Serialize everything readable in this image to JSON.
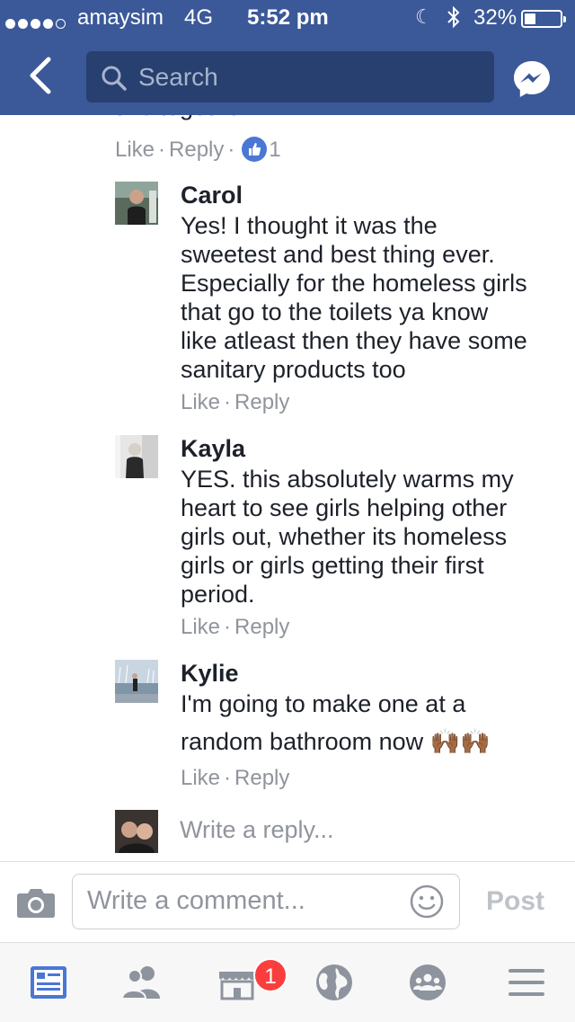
{
  "status_bar": {
    "carrier": "amaysim",
    "network": "4G",
    "time": "5:52 pm",
    "battery": "32%",
    "battery_level": 0.32
  },
  "header": {
    "search_placeholder": "Search"
  },
  "comment": {
    "cut_text": "this together!",
    "like": "Like",
    "reply": "Reply",
    "like_count": "1"
  },
  "replies": [
    {
      "name": "Carol",
      "text": "Yes! I thought it was the\nsweetest and best thing ever.\nEspecially for the homeless girls\nthat go to the toilets ya know\nlike atleast then they have some\nsanitary products too",
      "like": "Like",
      "reply": "Reply"
    },
    {
      "name": "Kayla",
      "text": "YES. this absolutely warms my\nheart to see girls helping other\ngirls out, whether its homeless\ngirls or girls getting their first\nperiod.",
      "like": "Like",
      "reply": "Reply"
    },
    {
      "name": "Kylie",
      "text_line1": "I'm going to make one at a",
      "text_line2": "random bathroom now",
      "emoji": "🙌🏾🙌🏾",
      "like": "Like",
      "reply": "Reply"
    }
  ],
  "write_reply_placeholder": "Write a reply...",
  "composer": {
    "placeholder": "Write a comment...",
    "post_label": "Post"
  },
  "tabbar": {
    "marketplace_badge": "1"
  },
  "colors": {
    "header_blue": "#3b5998",
    "link_blue": "#4a77d4",
    "badge_red": "#fa3e3e",
    "meta_gray": "#90949c"
  }
}
